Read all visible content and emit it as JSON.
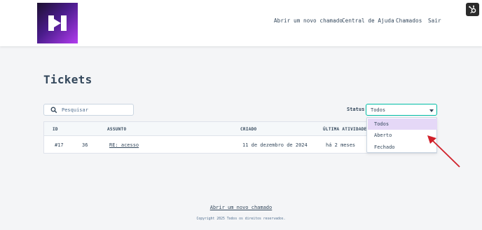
{
  "header": {
    "nav": [
      {
        "label": "Abrir um novo chamado"
      },
      {
        "label": "Central de Ajuda"
      },
      {
        "label": "Chamados"
      },
      {
        "label": "Sair"
      }
    ]
  },
  "page": {
    "title": "Tickets"
  },
  "search": {
    "placeholder": "Pesquisar",
    "value": ""
  },
  "filter": {
    "label": "Status",
    "selected": "Todos",
    "options": [
      "Todos",
      "Aberto",
      "Fechado"
    ]
  },
  "table": {
    "headers": [
      "ID",
      "ASSUNTO",
      "CRIADO",
      "ÚLTIMA ATIVIDADE"
    ],
    "rows": [
      {
        "id": "#17",
        "num": "36",
        "subject": "RE: acesso",
        "created": "11 de dezembro de 2024",
        "last_activity": "há 2 meses"
      }
    ]
  },
  "footer": {
    "link": "Abrir um novo chamado",
    "copyright": "Copyright 2025 Todos os direitos reservados."
  },
  "colors": {
    "accent_border": "#00bda5",
    "selected_option_bg": "#e5d8f7",
    "annotation_arrow": "#d0202a",
    "text": "#33475b"
  },
  "icons": [
    "brand-logo-icon",
    "hubspot-icon",
    "search-icon",
    "chevron-down-icon",
    "annotation-arrow"
  ]
}
